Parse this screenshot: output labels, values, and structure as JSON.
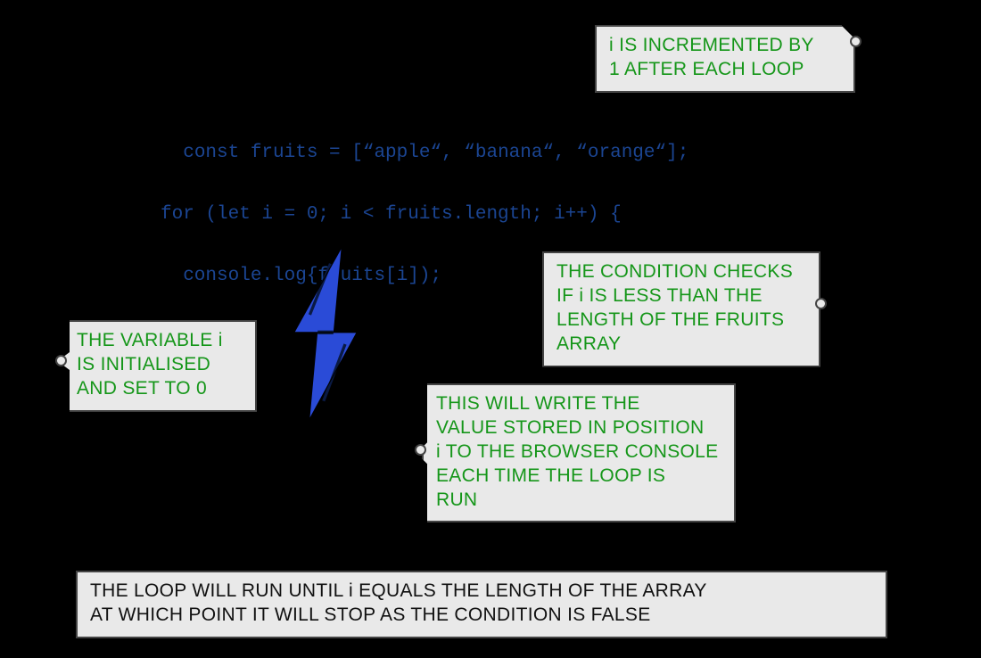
{
  "code": {
    "line1": "const fruits = [“apple“, “banana“, “orange“];",
    "line2": "",
    "line3": "for (let i = 0; i < fruits.length; i++) {",
    "line4": "",
    "line5": "  console.log{fruits[i]);",
    "line6": "",
    "line7": "}"
  },
  "callouts": {
    "increment": "i IS INCREMENTED BY\n1 AFTER EACH LOOP",
    "init": "THE VARIABLE i\nIS INITIALISED\nAND SET TO 0",
    "condition": "THE CONDITION CHECKS\nIF i IS LESS THAN THE\nLENGTH OF THE FRUITS\nARRAY",
    "log": "THIS WILL WRITE THE\nVALUE STORED IN POSITION\ni TO THE BROWSER CONSOLE\nEACH TIME THE LOOP IS\nRUN",
    "summary": "THE LOOP WILL RUN UNTIL i EQUALS THE LENGTH OF THE ARRAY\nAT WHICH POINT IT WILL STOP AS THE CONDITION IS FALSE"
  },
  "colors": {
    "code": "#1b4592",
    "callout_text": "#159619",
    "callout_bg": "#e9e9e9",
    "bolt": "#2a4bd7"
  }
}
